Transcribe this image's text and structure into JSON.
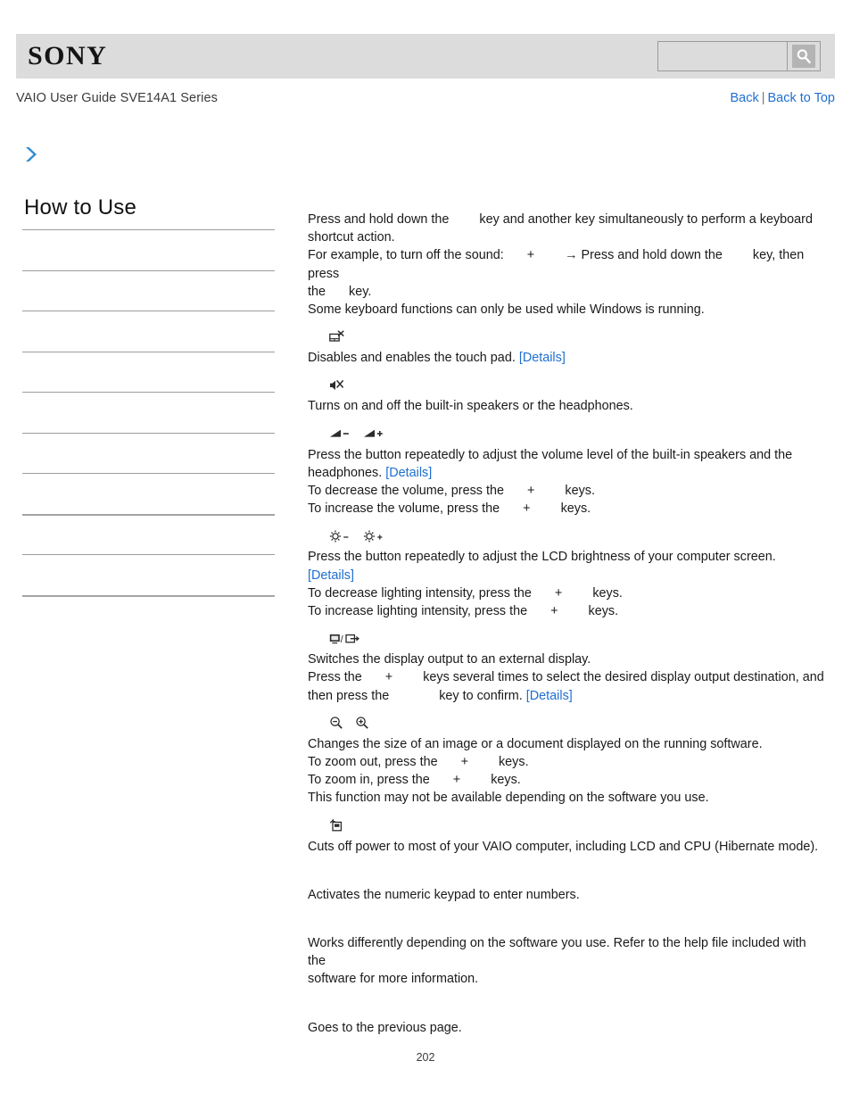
{
  "header": {
    "logo_text": "SONY",
    "search": {
      "value": "",
      "placeholder": "",
      "button_icon": "search-icon"
    }
  },
  "guide_bar": {
    "title": "VAIO User Guide SVE14A1 Series",
    "back_label": "Back",
    "separator": "|",
    "back_to_top_label": "Back to Top"
  },
  "breadcrumb": {
    "arrow_icon": "chevron-right-icon",
    "accent_color": "#2e8ccf"
  },
  "sidebar": {
    "title": "How to Use",
    "items": [
      {
        "label": "",
        "rule": "thin"
      },
      {
        "label": "",
        "rule": "thin"
      },
      {
        "label": "",
        "rule": "thin"
      },
      {
        "label": "",
        "rule": "thin"
      },
      {
        "label": "",
        "rule": "thin"
      },
      {
        "label": "",
        "rule": "thin"
      },
      {
        "label": "",
        "rule": "thin"
      },
      {
        "label": "",
        "rule": "thick"
      },
      {
        "label": "",
        "rule": "thin"
      },
      {
        "label": "",
        "rule": "thick"
      }
    ]
  },
  "content": {
    "intro": {
      "line1_a": "Press and hold down the",
      "line1_b": "key and another key simultaneously to perform a keyboard",
      "line2": "shortcut action.",
      "line3_a": "For example, to turn off the sound:",
      "line3_plus": "+",
      "line3_b": "→ Press and hold down the",
      "line3_c": "key, then press",
      "line4_a": "the",
      "line4_b": "key.",
      "line5": "Some keyboard functions can only be used while Windows is running."
    },
    "sections": [
      {
        "icons": [
          "touchpad-disable-icon"
        ],
        "lines": [
          {
            "text": "Disables and enables the touch pad.",
            "link": "[Details]"
          }
        ]
      },
      {
        "icons": [
          "speaker-mute-icon"
        ],
        "lines": [
          {
            "text": "Turns on and off the built-in speakers or the headphones."
          }
        ]
      },
      {
        "icons": [
          "volume-down-icon",
          "volume-up-icon"
        ],
        "lines": [
          {
            "text": "Press the button repeatedly to adjust the volume level of the built-in speakers and the"
          },
          {
            "text": "headphones.",
            "link": "[Details]"
          },
          {
            "pre": "To decrease the volume, press the",
            "plus": "+",
            "post": "keys."
          },
          {
            "pre": "To increase the volume, press the",
            "plus": "+",
            "post": "keys."
          }
        ]
      },
      {
        "icons": [
          "brightness-down-icon",
          "brightness-up-icon"
        ],
        "lines": [
          {
            "text": "Press the button repeatedly to adjust the LCD brightness of your computer screen.",
            "link": "[Details]"
          },
          {
            "pre": "To decrease lighting intensity, press the",
            "plus": "+",
            "post": "keys."
          },
          {
            "pre": "To increase lighting intensity, press the",
            "plus": "+",
            "post": "keys."
          }
        ]
      },
      {
        "icons": [
          "display-output-switch-icon"
        ],
        "lines": [
          {
            "text": "Switches the display output to an external display."
          },
          {
            "pre": "Press the",
            "plus": "+",
            "post": "keys several times to select the desired display output destination, and"
          },
          {
            "pre": "then press the",
            "post": "key to confirm.",
            "link": "[Details]"
          }
        ]
      },
      {
        "icons": [
          "zoom-out-icon",
          "zoom-in-icon"
        ],
        "lines": [
          {
            "text": "Changes the size of an image or a document displayed on the running software."
          },
          {
            "pre": "To zoom out, press the",
            "plus": "+",
            "post": "keys."
          },
          {
            "pre": "To zoom in, press the",
            "plus": "+",
            "post": "keys."
          },
          {
            "text": "This function may not be available depending on the software you use."
          }
        ]
      },
      {
        "icons": [
          "hibernate-icon"
        ],
        "lines": [
          {
            "text": "Cuts off power to most of your VAIO computer, including LCD and CPU (Hibernate mode)."
          }
        ]
      },
      {
        "icons": [],
        "lines": [
          {
            "text": "Activates the numeric keypad to enter numbers."
          }
        ]
      },
      {
        "icons": [],
        "lines": [
          {
            "text": "Works differently depending on the software you use. Refer to the help file included with the"
          },
          {
            "text": "software for more information."
          }
        ]
      },
      {
        "icons": [],
        "lines": [
          {
            "text": "Goes to the previous page."
          }
        ]
      }
    ]
  },
  "footer": {
    "page_number": "202"
  }
}
